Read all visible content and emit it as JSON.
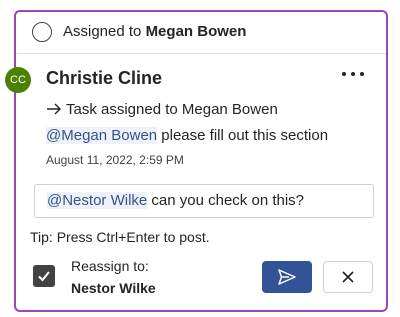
{
  "header": {
    "assigned_prefix": "Assigned to",
    "assignee": "Megan Bowen",
    "status_icon": "circle-outline-icon"
  },
  "comment": {
    "avatar_initials": "CC",
    "avatar_color": "#498205",
    "author": "Christie Cline",
    "more_icon": "more-horizontal-icon",
    "activity_text": "Task assigned to Megan Bowen",
    "activity_icon": "arrow-right-icon",
    "mention": "@Megan Bowen",
    "message_text": " please fill out this section",
    "timestamp": "August 11, 2022, 2:59 PM"
  },
  "reply": {
    "mention": "@Nestor Wilke",
    "text": " can you check on this?"
  },
  "tip": "Tip: Press Ctrl+Enter to post.",
  "reassign": {
    "checked": true,
    "label": "Reassign to:",
    "name": "Nestor Wilke"
  },
  "actions": {
    "send_icon": "send-icon",
    "cancel_icon": "close-icon",
    "send_color": "#325396"
  },
  "colors": {
    "card_border": "#9b47b3",
    "mention_text": "#33558c"
  }
}
